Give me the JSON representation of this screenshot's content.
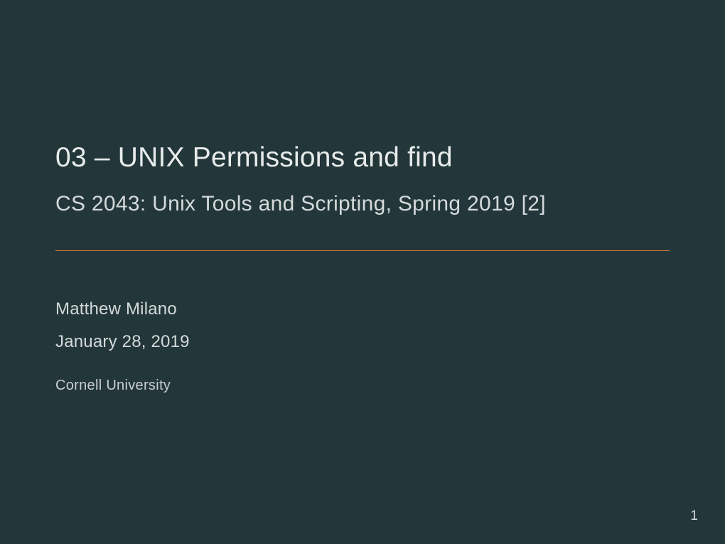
{
  "slide": {
    "title": "03 – UNIX Permissions and find",
    "subtitle": "CS 2043:  Unix Tools and Scripting, Spring 2019 [2]",
    "author": "Matthew Milano",
    "date": "January 28, 2019",
    "institution": "Cornell University",
    "page_number": "1"
  }
}
